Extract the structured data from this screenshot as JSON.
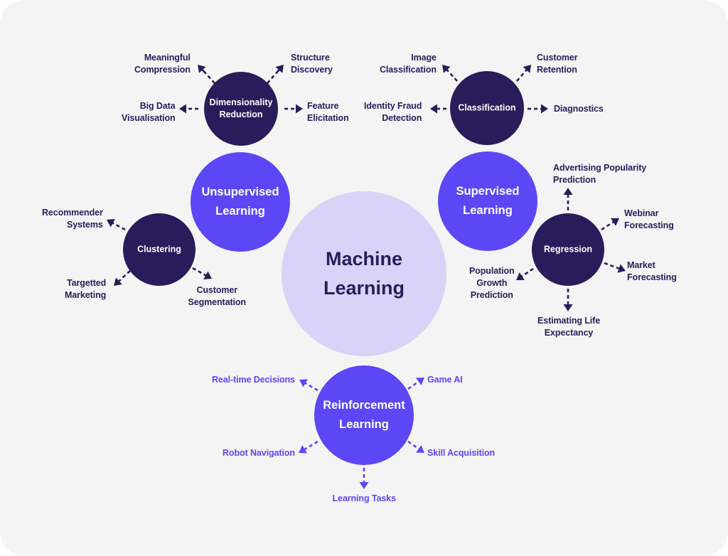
{
  "colors": {
    "background": "#f4f4f5",
    "core_fill": "#d8d3f7",
    "category_fill": "#5b47f5",
    "subcategory_fill": "#2a1c5a",
    "dark_text": "#2a1c5a",
    "accent_text": "#5b47f5",
    "light_text": "#ffffff"
  },
  "core": {
    "lines": [
      "Machine",
      "Learning"
    ]
  },
  "categories": {
    "unsupervised": {
      "lines": [
        "Unsupervised",
        "Learning"
      ]
    },
    "supervised": {
      "lines": [
        "Supervised",
        "Learning"
      ]
    },
    "reinforcement": {
      "lines": [
        "Reinforcement",
        "Learning"
      ]
    }
  },
  "subcategories": {
    "dimensionality_reduction": {
      "lines": [
        "Dimensionality",
        "Reduction"
      ],
      "outcomes": {
        "meaningful_compression": [
          "Meaningful",
          "Compression"
        ],
        "structure_discovery": [
          "Structure",
          "Discovery"
        ],
        "big_data_visualisation": [
          "Big Data",
          "Visualisation"
        ],
        "feature_elicitation": [
          "Feature",
          "Elicitation"
        ]
      }
    },
    "classification": {
      "lines": [
        "Classification"
      ],
      "outcomes": {
        "image_classification": [
          "Image",
          "Classification"
        ],
        "customer_retention": [
          "Customer",
          "Retention"
        ],
        "identity_fraud_detection": [
          "Identity Fraud",
          "Detection"
        ],
        "diagnostics": [
          "Diagnostics"
        ]
      }
    },
    "clustering": {
      "lines": [
        "Clustering"
      ],
      "outcomes": {
        "recommender_systems": [
          "Recommender",
          "Systems"
        ],
        "targetted_marketing": [
          "Targetted",
          "Marketing"
        ],
        "customer_segmentation": [
          "Customer",
          "Segmentation"
        ]
      }
    },
    "regression": {
      "lines": [
        "Regression"
      ],
      "outcomes": {
        "advertising_popularity_prediction": [
          "Advertising Popularity",
          "Prediction"
        ],
        "webinar_forecasting": [
          "Webinar",
          "Forecasting"
        ],
        "market_forecasting": [
          "Market",
          "Forecasting"
        ],
        "population_growth_prediction": [
          "Population",
          "Growth",
          "Prediction"
        ],
        "estimating_life_expectancy": [
          "Estimating Life",
          "Expectancy"
        ]
      }
    }
  },
  "reinforcement_outcomes": {
    "real_time_decisions": [
      "Real-time Decisions"
    ],
    "game_ai": [
      "Game AI"
    ],
    "robot_navigation": [
      "Robot Navigation"
    ],
    "skill_acquisition": [
      "Skill Acquisition"
    ],
    "learning_tasks": [
      "Learning Tasks"
    ]
  }
}
